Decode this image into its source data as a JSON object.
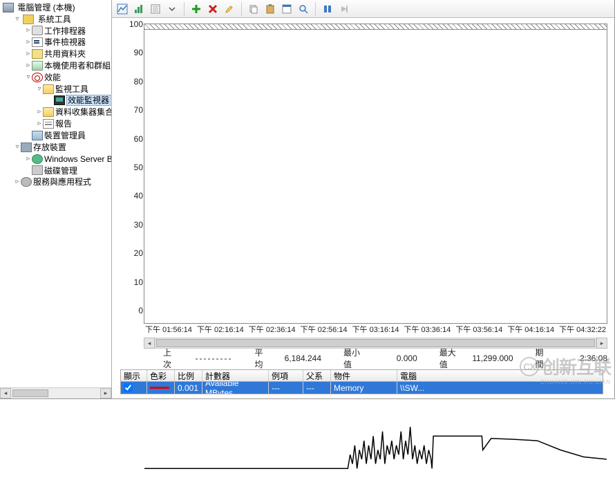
{
  "tree": {
    "root": "電腦管理 (本機)",
    "system_tools": "系統工具",
    "scheduler": "工作排程器",
    "event_viewer": "事件檢視器",
    "shared_folders": "共用資料夾",
    "users_groups": "本機使用者和群組",
    "performance": "效能",
    "monitoring_tools": "監視工具",
    "perf_monitor": "效能監視器",
    "data_collector": "資料收集器集合工具",
    "reports": "報告",
    "device_manager": "裝置管理員",
    "storage": "存放裝置",
    "server_backup": "Windows Server Backu..",
    "disk_mgmt": "磁碟管理",
    "services_apps": "服務與應用程式"
  },
  "toolbar": {
    "view_icons": [
      "view-graph-icon",
      "view-histogram-icon",
      "view-report-icon"
    ],
    "add": "add-counter-icon",
    "delete": "delete-counter-icon",
    "highlight": "highlight-icon",
    "copy": "copy-icon",
    "paste": "paste-icon",
    "properties": "properties-icon",
    "zoom": "zoom-icon",
    "freeze": "freeze-icon",
    "update": "update-icon"
  },
  "stats": {
    "last_label": "上次",
    "last_value": "---------",
    "avg_label": "平均",
    "avg_value": "6,184.244",
    "min_label": "最小值",
    "min_value": "0.000",
    "max_label": "最大值",
    "max_value": "11,299.000",
    "dur_label": "期間",
    "dur_value": "2:36:08"
  },
  "grid": {
    "headers": {
      "show": "顯示",
      "color": "色彩",
      "scale": "比例",
      "counter": "計數器",
      "instance": "例項",
      "parent": "父系",
      "object": "物件",
      "computer": "電腦"
    },
    "row": {
      "show": true,
      "scale": "0.001",
      "counter": "Available MBytes",
      "instance": "---",
      "parent": "---",
      "object": "Memory",
      "computer": "\\\\SW..."
    },
    "widths": [
      38,
      40,
      40,
      96,
      50,
      40,
      96,
      200
    ]
  },
  "chart_data": {
    "type": "line",
    "title": "",
    "ylabel": "",
    "xlabel": "",
    "yticks": [
      100,
      90,
      80,
      70,
      60,
      50,
      40,
      30,
      20,
      10,
      0
    ],
    "ylim": [
      0,
      100
    ],
    "xticks": [
      "下午 01:56:14",
      "下午 02:16:14",
      "下午 02:36:14",
      "下午 02:56:14",
      "下午 03:16:14",
      "下午 03:36:14",
      "下午 03:56:14",
      "下午 04:16:14",
      "下午 04:32:22"
    ],
    "series": [
      {
        "name": "Available MBytes (×0.001)",
        "color": "#000",
        "x": [
          0,
          0.44,
          0.445,
          0.45,
          0.455,
          0.46,
          0.465,
          0.47,
          0.475,
          0.48,
          0.485,
          0.49,
          0.495,
          0.5,
          0.505,
          0.51,
          0.515,
          0.52,
          0.525,
          0.53,
          0.535,
          0.54,
          0.545,
          0.55,
          0.555,
          0.56,
          0.565,
          0.57,
          0.575,
          0.58,
          0.585,
          0.59,
          0.595,
          0.6,
          0.605,
          0.61,
          0.615,
          0.62,
          0.622,
          0.625,
          0.65,
          0.7,
          0.73,
          0.732,
          0.75,
          0.8,
          0.85,
          0.9,
          0.95,
          1.0
        ],
        "y": [
          4,
          4,
          7,
          5,
          9,
          4,
          8,
          6,
          10,
          5,
          9,
          6,
          11,
          5,
          8,
          6,
          12,
          5,
          9,
          7,
          10,
          6,
          9,
          7,
          12,
          6,
          10,
          7,
          13,
          6,
          9,
          5,
          8,
          6,
          9,
          5,
          8,
          6,
          4,
          11,
          11,
          11,
          11,
          8,
          10.5,
          10.3,
          10,
          8,
          6.5,
          6
        ]
      }
    ]
  },
  "watermark": {
    "brand": "创新互联",
    "sub": "CHUANG.XIN.HU.LIAN",
    "logo": "CX"
  }
}
